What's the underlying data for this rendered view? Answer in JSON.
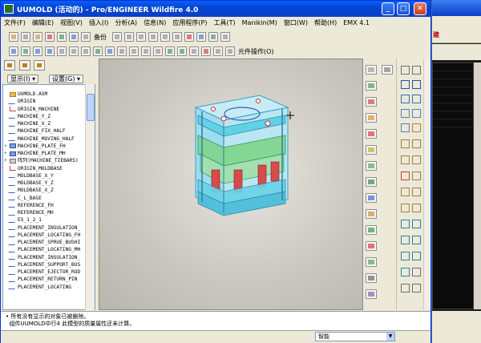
{
  "window": {
    "title": "UUMOLD (活动的) - Pro/ENGINEER Wildfire 4.0",
    "min_label": "_",
    "max_label": "□",
    "close_label": "✕"
  },
  "menu": [
    "文件(F)",
    "编辑(E)",
    "视图(V)",
    "插入(I)",
    "分析(A)",
    "信息(N)",
    "应用程序(P)",
    "工具(T)",
    "Manikin(M)",
    "窗口(W)",
    "帮助(H)",
    "EMX 4.1"
  ],
  "toolbar": {
    "backup_label": "备份",
    "component_op_label": "元件操作(O)"
  },
  "model_tree": {
    "show_label": "显示(I) ▾",
    "settings_label": "设置(G) ▾",
    "items": [
      {
        "label": "UUMOLD.ASM",
        "icon": "asm",
        "expand": ""
      },
      {
        "label": "ORIGIN",
        "icon": "datum",
        "expand": ""
      },
      {
        "label": "ORIGIN_MACHINE",
        "icon": "csys",
        "expand": ""
      },
      {
        "label": "MACHINE_Y_Z",
        "icon": "datum",
        "expand": ""
      },
      {
        "label": "MACHINE_X_Z",
        "icon": "datum",
        "expand": ""
      },
      {
        "label": "MACHINE_FIX_HALF",
        "icon": "datum",
        "expand": ""
      },
      {
        "label": "MACHINE_MOVING_HALF",
        "icon": "datum",
        "expand": ""
      },
      {
        "label": "MACHINE_PLATE_FH",
        "icon": "sub",
        "expand": "+"
      },
      {
        "label": "MACHINE_PLATE_MH",
        "icon": "sub",
        "expand": "+"
      },
      {
        "label": "阵列(MACHINE_TIEBARS)",
        "icon": "pat",
        "expand": "+"
      },
      {
        "label": "ORIGIN_MOLDBASE",
        "icon": "csys",
        "expand": ""
      },
      {
        "label": "MOLDBASE_X_Y",
        "icon": "datum",
        "expand": ""
      },
      {
        "label": "MOLDBASE_Y_Z",
        "icon": "datum",
        "expand": ""
      },
      {
        "label": "MOLDBASE_X_Z",
        "icon": "datum",
        "expand": ""
      },
      {
        "label": "C_L_BASE",
        "icon": "datum",
        "expand": ""
      },
      {
        "label": "REFERENCE_FH",
        "icon": "datum",
        "expand": ""
      },
      {
        "label": "REFERENCE_MH",
        "icon": "datum",
        "expand": ""
      },
      {
        "label": "ES_1_2_1",
        "icon": "datum",
        "expand": ""
      },
      {
        "label": "PLACEMENT_INSULATION_",
        "icon": "datum",
        "expand": ""
      },
      {
        "label": "PLACEMENT_LOCATING_FH",
        "icon": "datum",
        "expand": ""
      },
      {
        "label": "PLACEMENT_SPRUE_BUSHI",
        "icon": "datum",
        "expand": ""
      },
      {
        "label": "PLACEMENT_LOCATING_MH",
        "icon": "datum",
        "expand": ""
      },
      {
        "label": "PLACEMENT_INSULATION_",
        "icon": "datum",
        "expand": ""
      },
      {
        "label": "PLACEMENT_SUPPORT_BUS",
        "icon": "datum",
        "expand": ""
      },
      {
        "label": "PLACEMENT_EJECTOR_ROD",
        "icon": "datum",
        "expand": ""
      },
      {
        "label": "PLACEMENT_RETURN_PIN",
        "icon": "datum",
        "expand": ""
      },
      {
        "label": "PLACEMENT_LOCATING",
        "icon": "datum",
        "expand": ""
      }
    ]
  },
  "messages": [
    "所有没有显示的对象已被删除。",
    "组件UUMOLD中行4 此模型的质量属性还未计算。"
  ],
  "status": {
    "filter_value": "智能"
  },
  "second_window": {
    "toolbar_label": "建"
  },
  "colors": {
    "title_blue": "#0046d5",
    "viewport_bg": "#d6d4ce",
    "model_green": "#5cc47a",
    "model_cyan": "#5fd0e6",
    "model_red": "#d04040"
  }
}
